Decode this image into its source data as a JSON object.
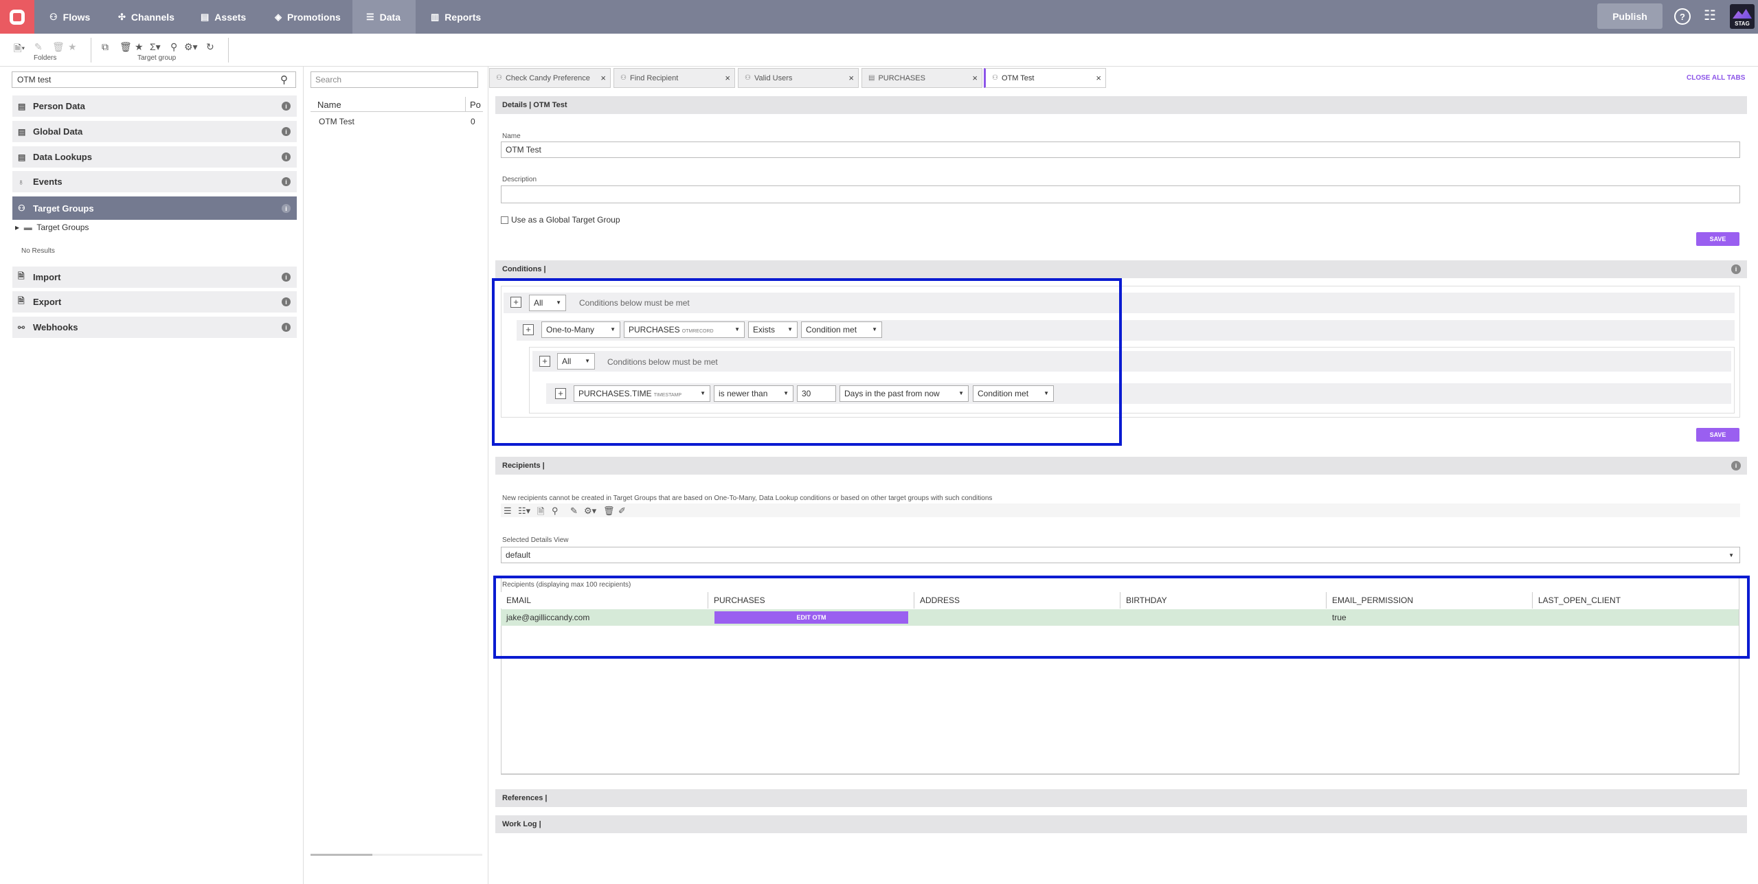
{
  "nav": {
    "items": [
      {
        "label": "Flows",
        "icon": "flows-icon"
      },
      {
        "label": "Channels",
        "icon": "channels-icon"
      },
      {
        "label": "Assets",
        "icon": "assets-icon"
      },
      {
        "label": "Promotions",
        "icon": "promotions-icon"
      },
      {
        "label": "Data",
        "icon": "data-icon",
        "active": true
      },
      {
        "label": "Reports",
        "icon": "reports-icon"
      }
    ],
    "publish": "Publish",
    "help": "?",
    "env_badge": "STAG"
  },
  "toolbar": {
    "folders_label": "Folders",
    "target_group_label": "Target group"
  },
  "left": {
    "search_value": "OTM test",
    "items": [
      "Person Data",
      "Global Data",
      "Data Lookups",
      "Events",
      "Target Groups",
      "Import",
      "Export",
      "Webhooks"
    ],
    "tree_node": "Target Groups",
    "no_results": "No Results"
  },
  "middle": {
    "search_placeholder": "Search",
    "col_name": "Name",
    "col_po": "Po",
    "row_name": "OTM Test",
    "row_po": "0"
  },
  "tabs": {
    "items": [
      "Check Candy Preference",
      "Find Recipient",
      "Valid Users",
      "PURCHASES",
      "OTM Test"
    ],
    "close_all": "CLOSE ALL TABS"
  },
  "details": {
    "header": "Details | OTM Test",
    "name_label": "Name",
    "name_value": "OTM Test",
    "desc_label": "Description",
    "global_checkbox": "Use as a Global Target Group",
    "save": "SAVE"
  },
  "conditions": {
    "header": "Conditions |",
    "row1": {
      "mode": "All",
      "text": "Conditions below must be met"
    },
    "row2": {
      "relation": "One-to-Many",
      "field": "PURCHASES",
      "field_type": "OTMRECORD",
      "op": "Exists",
      "state": "Condition met"
    },
    "row3": {
      "mode": "All",
      "text": "Conditions below must be met"
    },
    "row4": {
      "field": "PURCHASES.TIME",
      "field_type": "TIMESTAMP",
      "op": "is newer than",
      "value": "30",
      "unit": "Days in the past from now",
      "state": "Condition met"
    },
    "save": "SAVE"
  },
  "recipients": {
    "header": "Recipients |",
    "notice": "New recipients cannot be created in Target Groups that are based on One-To-Many, Data Lookup conditions or based on other target groups with such conditions",
    "view_label": "Selected Details View",
    "view_value": "default",
    "table_caption": "Recipients (displaying max 100 recipients)",
    "columns": [
      "EMAIL",
      "PURCHASES",
      "ADDRESS",
      "BIRTHDAY",
      "EMAIL_PERMISSION",
      "LAST_OPEN_CLIENT"
    ],
    "row": {
      "email": "jake@agilliccandy.com",
      "purchases_button": "EDIT OTM",
      "email_permission": "true"
    }
  },
  "references_header": "References |",
  "worklog_header": "Work Log |",
  "colors": {
    "nav_bg": "#7b8095",
    "accent": "#9a5ff0",
    "logo": "#ea5a61",
    "highlight": "#0a1bd1"
  }
}
